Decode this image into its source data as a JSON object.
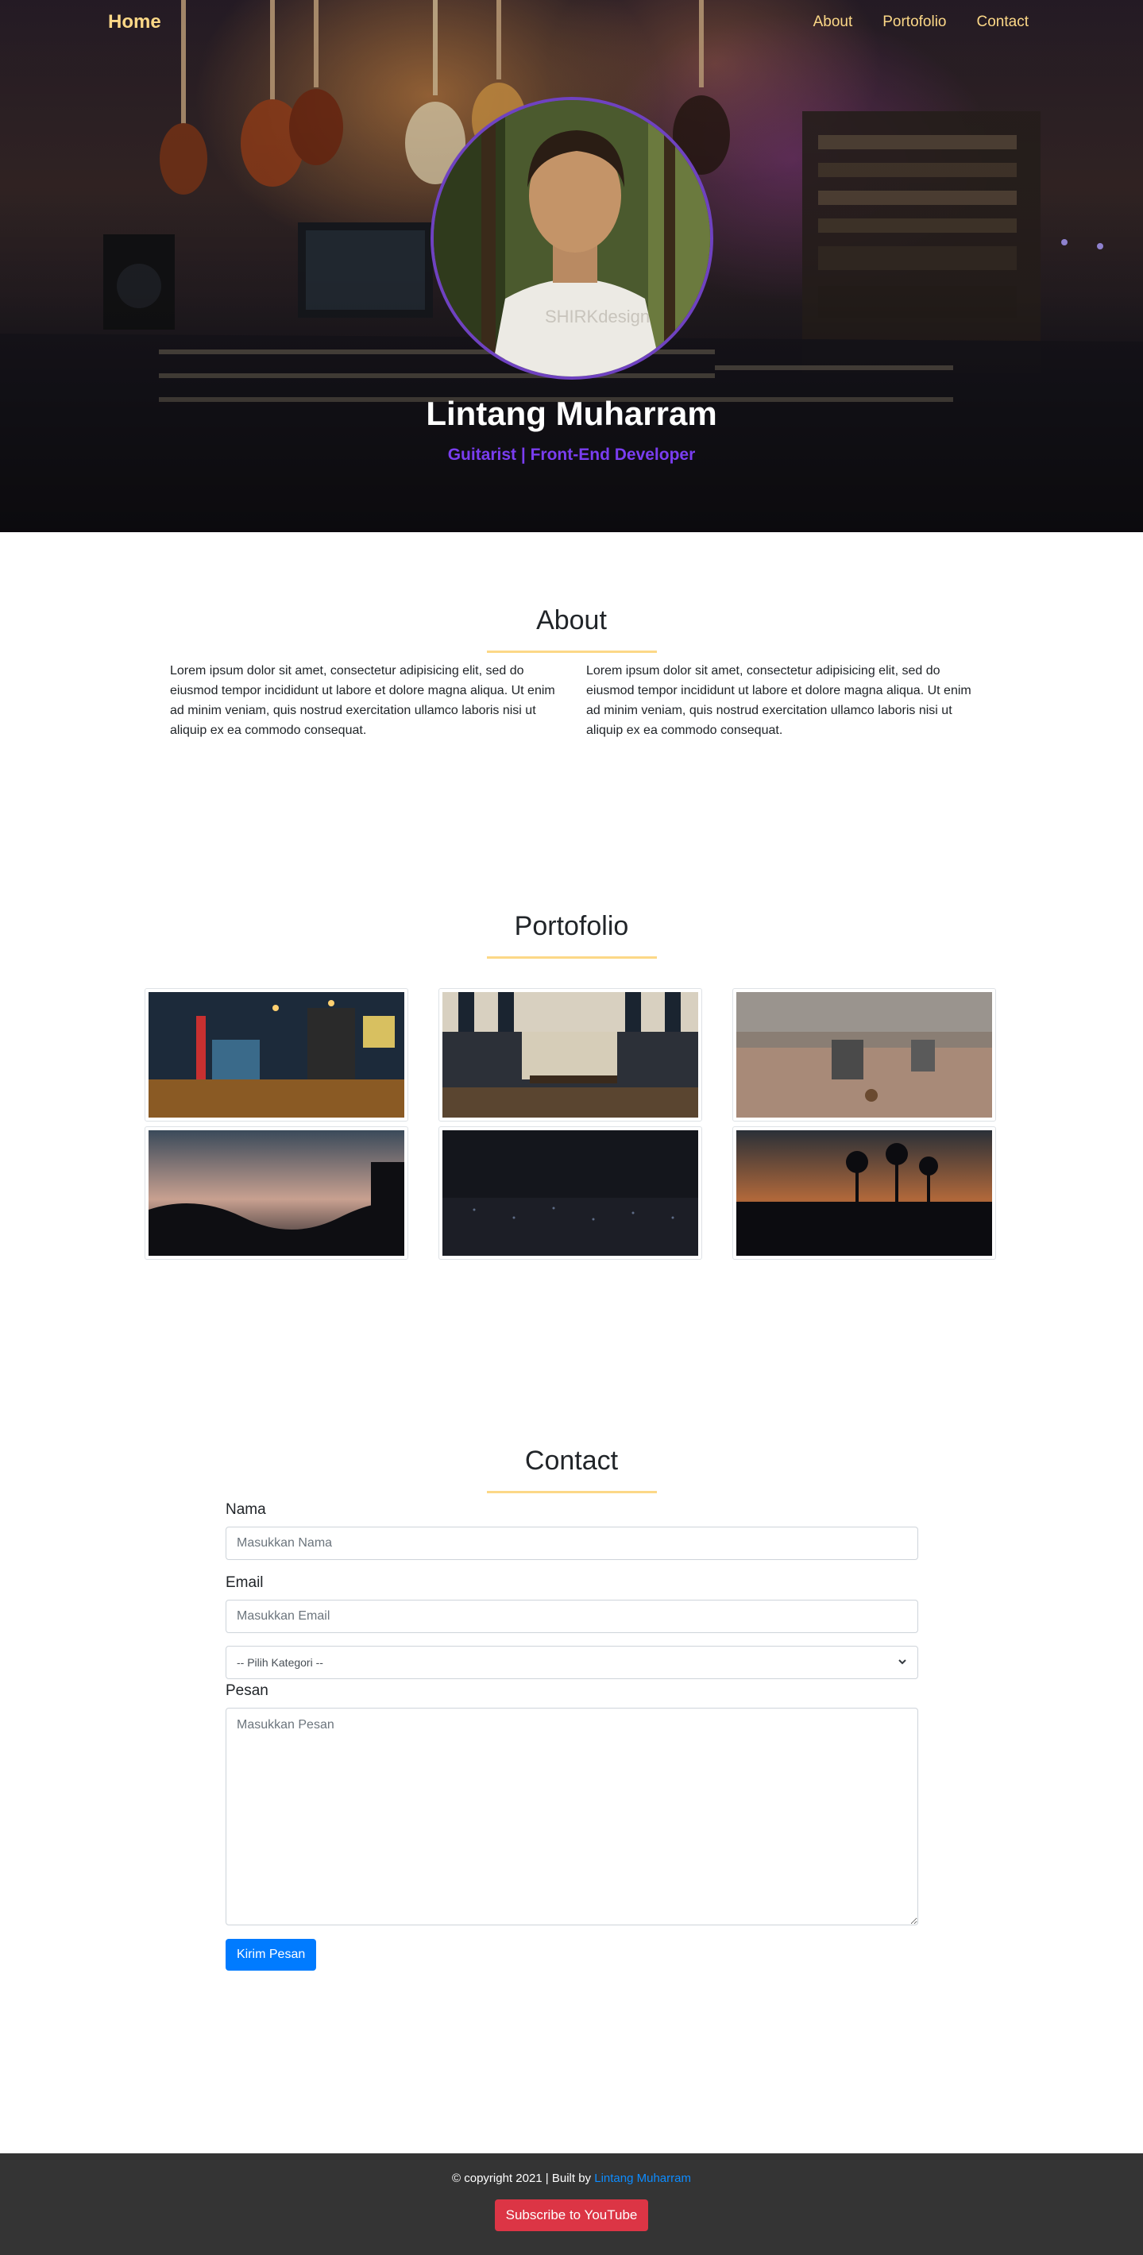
{
  "navbar": {
    "brand": "Home",
    "links": [
      "About",
      "Portofolio",
      "Contact"
    ]
  },
  "hero": {
    "name": "Lintang Muharram",
    "subtitle": "Guitarist | Front-End Developer"
  },
  "about": {
    "title": "About",
    "paragraphs": [
      "Lorem ipsum dolor sit amet, consectetur adipisicing elit, sed do eiusmod tempor incididunt ut labore et dolore magna aliqua. Ut enim ad minim veniam, quis nostrud exercitation ullamco laboris nisi ut aliquip ex ea commodo consequat.",
      "Lorem ipsum dolor sit amet, consectetur adipisicing elit, sed do eiusmod tempor incididunt ut labore et dolore magna aliqua. Ut enim ad minim veniam, quis nostrud exercitation ullamco laboris nisi ut aliquip ex ea commodo consequat."
    ]
  },
  "portfolio": {
    "title": "Portofolio"
  },
  "contact": {
    "title": "Contact",
    "name_label": "Nama",
    "name_placeholder": "Masukkan Nama",
    "email_label": "Email",
    "email_placeholder": "Masukkan Email",
    "category_selected": "-- Pilih Kategori --",
    "message_label": "Pesan",
    "message_placeholder": "Masukkan Pesan",
    "submit_label": "Kirim Pesan"
  },
  "footer": {
    "copyright": "© copyright 2021 | Built by ",
    "author": "Lintang Muharram",
    "subscribe_label": "Subscribe to YouTube"
  },
  "colors": {
    "accent_yellow": "#fcd887",
    "accent_purple": "#6f42c1",
    "primary_blue": "#007bff",
    "danger_red": "#dc3545",
    "footer_bg": "#343434"
  }
}
